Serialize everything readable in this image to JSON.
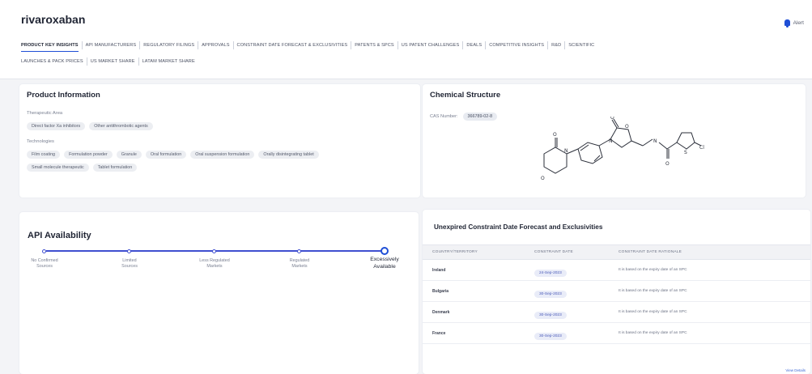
{
  "header": {
    "title": "rivaroxaban",
    "alert_label": "Alert"
  },
  "tabs_row1": [
    "PRODUCT KEY INSIGHTS",
    "API MANUFACTURERS",
    "REGULATORY FILINGS",
    "APPROVALS",
    "CONSTRAINT DATE FORECAST & EXCLUSIVITIES",
    "PATENTS & SPCS",
    "US PATENT CHALLENGES",
    "DEALS",
    "COMPETITIVE INSIGHTS",
    "R&D",
    "SCIENTIFIC"
  ],
  "tabs_row2": [
    "LAUNCHES & PACK PRICES",
    "US MARKET SHARE",
    "LATAM MARKET SHARE"
  ],
  "product_info": {
    "title": "Product Information",
    "therapeutic_area_label": "Therapeutic Area",
    "therapeutic_areas": [
      "Direct factor Xa inhibitors",
      "Other antithrombotic agents"
    ],
    "technologies_label": "Technologies",
    "technologies_row1": [
      "Film coating",
      "Formulation powder",
      "Granule",
      "Oral formulation",
      "Oral suspension formulation",
      "Orally disintegrating tablet"
    ],
    "technologies_row2": [
      "Small molecule therapeutic",
      "Tablet formulation"
    ]
  },
  "chemical": {
    "title": "Chemical Structure",
    "cas_label": "CAS Number:",
    "cas_value": "366789-02-8"
  },
  "api": {
    "title": "API Availability",
    "stops": [
      {
        "line1": "No Confirmed",
        "line2": "Sources"
      },
      {
        "line1": "Limited",
        "line2": "Sources"
      },
      {
        "line1": "Less Regulated",
        "line2": "Markets"
      },
      {
        "line1": "Regulated",
        "line2": "Markets"
      },
      {
        "line1": "Excessively",
        "line2": "Available"
      }
    ],
    "level": 1.0
  },
  "forecast": {
    "title": "Unexpired Constraint Date Forecast and Exclusivities",
    "columns": [
      "COUNTRY/TERRITORY",
      "CONSTRAINT DATE",
      "CONSTRAINT DATE RATIONALE"
    ],
    "rows": [
      {
        "country": "Ireland",
        "date": "24-Sep-2023",
        "rationale": "It is based on the expiry date of an SPC"
      },
      {
        "country": "Bulgaria",
        "date": "30-Sep-2023",
        "rationale": "It is based on the expiry date of an SPC"
      },
      {
        "country": "Denmark",
        "date": "30-Sep-2023",
        "rationale": "It is based on the expiry date of an SPC"
      },
      {
        "country": "France",
        "date": "30-Sep-2023",
        "rationale": "It is based on the expiry date of an SPC"
      }
    ],
    "view_details": "View Details"
  },
  "colors": {
    "accent": "#1f4fd6",
    "track": "#3f4fd0"
  }
}
